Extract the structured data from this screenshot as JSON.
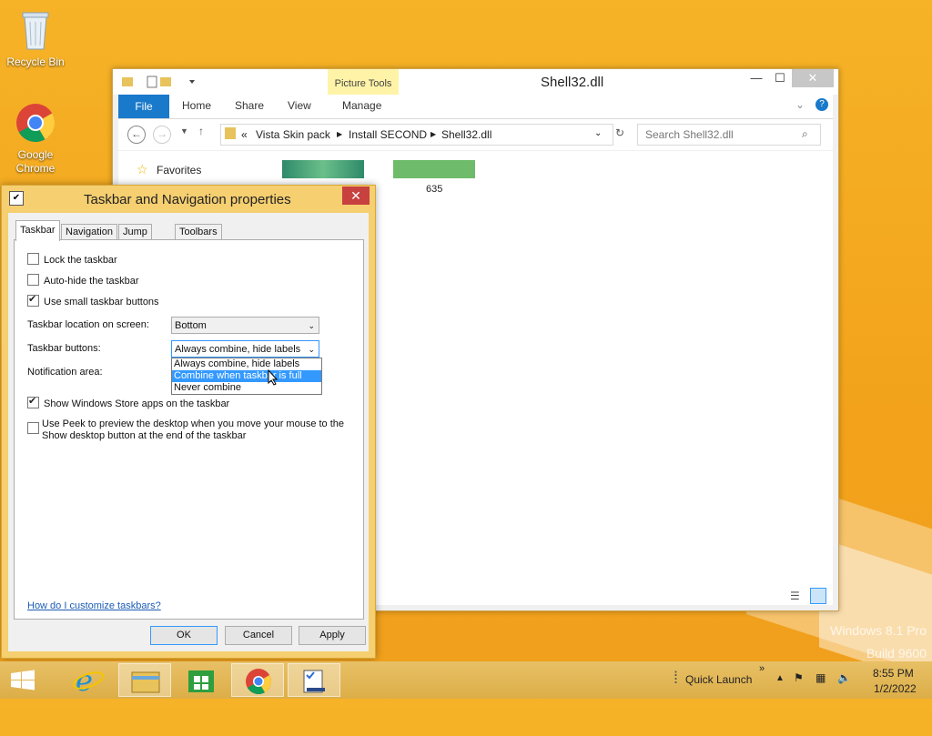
{
  "desktop": {
    "icons": [
      {
        "label": "Recycle Bin",
        "icon": "recycle-bin-icon"
      },
      {
        "label": "Google Chrome",
        "icon": "chrome-icon"
      }
    ],
    "watermark": {
      "line1": "Windows 8.1 Pro",
      "line2": "Build 9600"
    }
  },
  "explorer": {
    "title": "Shell32.dll",
    "picture_tools": "Picture Tools",
    "ribbon_tabs": [
      "File",
      "Home",
      "Share",
      "View",
      "Manage"
    ],
    "address": {
      "prefix": "«",
      "parts": [
        "Vista Skin pack",
        "Install SECOND",
        "Shell32.dll"
      ]
    },
    "search_placeholder": "Search Shell32.dll",
    "nav": {
      "favorites": "Favorites"
    },
    "items": [
      {
        "label": ""
      },
      {
        "label": "635"
      }
    ]
  },
  "dialog": {
    "title": "Taskbar and Navigation properties",
    "tabs": [
      "Taskbar",
      "Navigation",
      "Jump Lists",
      "Toolbars"
    ],
    "checkboxes": {
      "lock": {
        "label": "Lock the taskbar",
        "checked": false
      },
      "autohide": {
        "label": "Auto-hide the taskbar",
        "checked": false
      },
      "small": {
        "label": "Use small taskbar buttons",
        "checked": true
      },
      "store": {
        "label": "Show Windows Store apps on the taskbar",
        "checked": true
      },
      "peek_line1": "Use Peek to preview the desktop when you move your mouse to the",
      "peek_line2": "Show desktop button at the end of the taskbar"
    },
    "location_label": "Taskbar location on screen:",
    "location_value": "Bottom",
    "buttons_label": "Taskbar buttons:",
    "buttons_value": "Always combine, hide labels",
    "buttons_options": [
      "Always combine, hide labels",
      "Combine when taskbar is full",
      "Never combine"
    ],
    "notification_label": "Notification area:",
    "help_link": "How do I customize taskbars?",
    "ok": "OK",
    "cancel": "Cancel",
    "apply": "Apply"
  },
  "taskbar": {
    "quick_launch": "Quick Launch",
    "time": "8:55 PM",
    "date": "1/2/2022"
  }
}
